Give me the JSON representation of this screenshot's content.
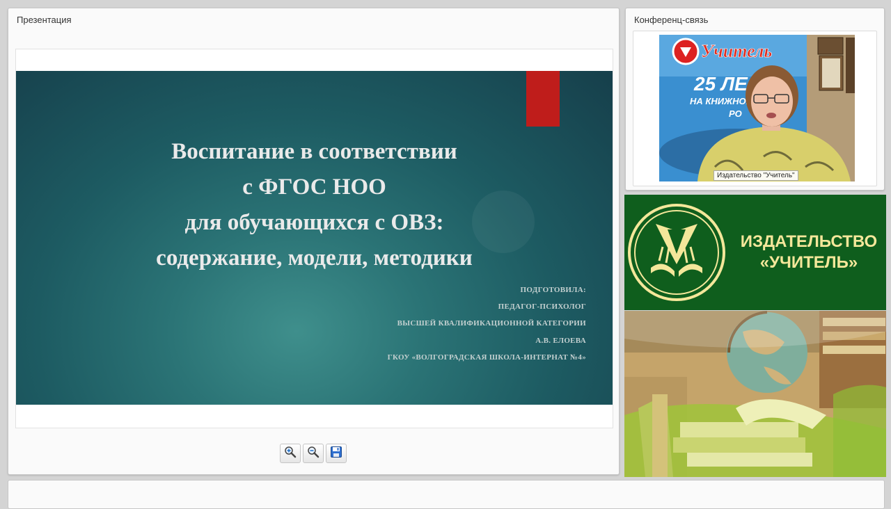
{
  "presentation": {
    "title": "Презентация",
    "slide": {
      "title_lines": [
        "Воспитание  в соответствии",
        "с ФГОС НОО",
        "для обучающихся с ОВЗ:",
        "содержание, модели, методики"
      ],
      "author_lines": [
        "ПОДГОТОВИЛА:",
        "ПЕДАГОГ-ПСИХОЛОГ",
        "ВЫСШЕЙ КВАЛИФИКАЦИОННОЙ КАТЕГОРИИ",
        "А.В. ЕЛОЕВА",
        "ГКОУ «ВОЛГОГРАДСКАЯ ШКОЛА-ИНТЕРНАТ №4»"
      ]
    },
    "toolbar": {
      "zoom_in_icon": "zoom-in-icon",
      "zoom_out_icon": "zoom-out-icon",
      "save_icon": "floppy-disk-icon"
    }
  },
  "conference": {
    "title": "Конференц-связь",
    "video_caption": "Издательство \"Учитель\"",
    "poster_text": {
      "brand": "Учитель",
      "years": "25 ЛЕ",
      "line": "НА КНИЖНОМ",
      "line2": "РО"
    }
  },
  "logo_banner": {
    "line1": "ИЗДАТЕЛЬСТВО",
    "line2": "«УЧИТЕЛЬ»"
  },
  "colors": {
    "slide_bg": "#1d5b62",
    "slide_accent_red": "#bf1d1b",
    "logo_bg": "#0f5e1d",
    "logo_text": "#f4e79a"
  }
}
